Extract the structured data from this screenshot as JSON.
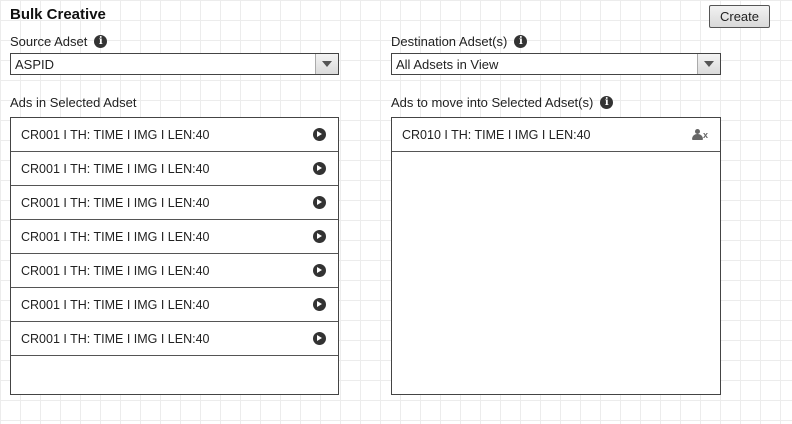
{
  "header": {
    "title": "Bulk Creative",
    "create_label": "Create"
  },
  "source": {
    "label": "Source Adset",
    "value": "ASPID",
    "list_label": "Ads in Selected Adset",
    "items": [
      {
        "label": "CR001 I TH: TIME I IMG I LEN:40",
        "icon": "arrow-circle-right-icon"
      },
      {
        "label": "CR001 I TH: TIME I IMG I LEN:40",
        "icon": "arrow-circle-right-icon"
      },
      {
        "label": "CR001 I TH: TIME I IMG I LEN:40",
        "icon": "arrow-circle-right-icon"
      },
      {
        "label": "CR001 I TH: TIME I IMG I LEN:40",
        "icon": "arrow-circle-right-icon"
      },
      {
        "label": "CR001 I TH: TIME I IMG I LEN:40",
        "icon": "arrow-circle-right-icon"
      },
      {
        "label": "CR001 I TH: TIME I IMG I LEN:40",
        "icon": "arrow-circle-right-icon"
      },
      {
        "label": "CR001 I TH: TIME I IMG I LEN:40",
        "icon": "arrow-circle-right-icon"
      }
    ]
  },
  "destination": {
    "label": "Destination Adset(s)",
    "value": "All Adsets in View",
    "list_label": "Ads to move into Selected Adset(s)",
    "items": [
      {
        "label": "CR010 I TH: TIME I IMG I LEN:40",
        "icon": "remove-user-icon"
      }
    ]
  },
  "icons": {
    "info": "info-icon",
    "dropdown": "chevron-down-icon"
  }
}
